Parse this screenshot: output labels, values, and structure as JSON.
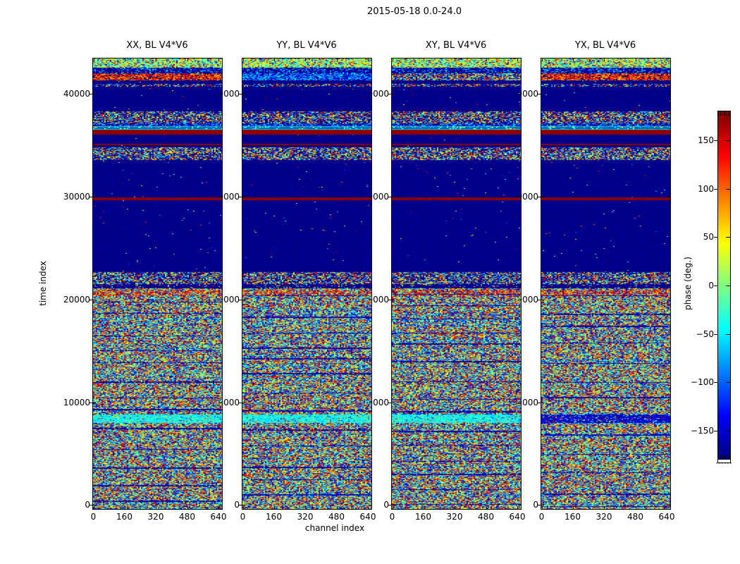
{
  "figure": {
    "title": "2015-05-18 0.0-24.0"
  },
  "axes": {
    "xlabel": "channel index",
    "ylabel": "time index",
    "x_ticks": [
      "0",
      "160",
      "320",
      "480",
      "640"
    ],
    "y_ticks": [
      "40000",
      "30000",
      "20000",
      "10000",
      "0"
    ]
  },
  "colorbar": {
    "label": "phase (deg.)",
    "ticks": [
      "150",
      "100",
      "50",
      "0",
      "−50",
      "−100",
      "−150"
    ]
  },
  "chart_data": {
    "type": "heatmap",
    "title": "2015-05-18 0.0-24.0",
    "xlabel": "channel index",
    "ylabel": "time index",
    "xlim": [
      0,
      657
    ],
    "ylim": [
      0,
      43300
    ],
    "x_tick_values": [
      0,
      160,
      320,
      480,
      640
    ],
    "y_tick_values": [
      0,
      10000,
      20000,
      30000,
      40000
    ],
    "value_label": "phase (deg.)",
    "value_range": [
      -180,
      180
    ],
    "colormap": "jet",
    "colorbar_tick_values": [
      150,
      100,
      50,
      0,
      -50,
      -100,
      -150
    ],
    "legend_position": "right-colorbar",
    "grid": false,
    "panels": [
      {
        "title": "XX, BL V4*V6",
        "pol": "XX",
        "top_band_palette": "hot",
        "bottom_bright_stripe": true
      },
      {
        "title": "YY, BL V4*V6",
        "pol": "YY",
        "top_band_palette": "cool",
        "bottom_bright_stripe": true
      },
      {
        "title": "XY, BL V4*V6",
        "pol": "XY",
        "top_band_palette": "mixed",
        "bottom_bright_stripe": true
      },
      {
        "title": "YX, BL V4*V6",
        "pol": "YX",
        "top_band_palette": "hot",
        "bottom_bright_stripe": false
      }
    ],
    "pattern": {
      "note": "horizontal band structure of each phase heatmap; 'from'/'to' are fractions of panel height measured from the top; phase values in degrees, jet colormap",
      "bands": [
        {
          "from": 0.0,
          "to": 0.02,
          "type": "bright-noise"
        },
        {
          "from": 0.02,
          "to": 0.032,
          "type": "speckle",
          "density": 0.35,
          "palette": "cool"
        },
        {
          "from": 0.032,
          "to": 0.047,
          "type": "speckle",
          "density": 0.8,
          "palette": "per-panel"
        },
        {
          "from": 0.047,
          "to": 0.056,
          "type": "flat-min"
        },
        {
          "from": 0.056,
          "to": 0.062,
          "type": "speckle",
          "density": 0.5,
          "palette": "mixed"
        },
        {
          "from": 0.062,
          "to": 0.117,
          "type": "flat-min"
        },
        {
          "from": 0.117,
          "to": 0.143,
          "type": "speckle",
          "density": 0.65,
          "palette": "mixed"
        },
        {
          "from": 0.143,
          "to": 0.15,
          "type": "speckle",
          "density": 0.55,
          "palette": "cool"
        },
        {
          "from": 0.15,
          "to": 0.157,
          "type": "cyan-lines"
        },
        {
          "from": 0.157,
          "to": 0.168,
          "type": "flat-max"
        },
        {
          "from": 0.168,
          "to": 0.188,
          "type": "flat-min"
        },
        {
          "from": 0.188,
          "to": 0.192,
          "type": "flat-max"
        },
        {
          "from": 0.192,
          "to": 0.197,
          "type": "flat-min"
        },
        {
          "from": 0.197,
          "to": 0.224,
          "type": "speckle",
          "density": 0.7,
          "palette": "mixed"
        },
        {
          "from": 0.224,
          "to": 0.308,
          "type": "flat-min"
        },
        {
          "from": 0.308,
          "to": 0.313,
          "type": "flat-max"
        },
        {
          "from": 0.313,
          "to": 0.474,
          "type": "flat-min"
        },
        {
          "from": 0.474,
          "to": 0.5,
          "type": "speckle",
          "density": 0.65,
          "palette": "mixed"
        },
        {
          "from": 0.5,
          "to": 0.509,
          "type": "speckle",
          "density": 0.12,
          "palette": "mixed"
        },
        {
          "from": 0.509,
          "to": 1.0,
          "type": "random-noise"
        }
      ],
      "noise_features": {
        "red_rows": [
          0.512,
          0.527
        ],
        "bright_stripe": [
          0.79,
          0.808
        ],
        "thin_dark_line_spacing_rows": [
          14,
          32
        ]
      }
    }
  }
}
